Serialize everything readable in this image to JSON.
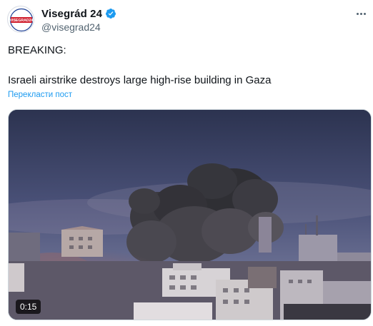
{
  "account": {
    "display_name": "Visegrád 24",
    "handle": "@visegrad24",
    "avatar_text": "VISEGRAD24",
    "verified_icon": "verified-badge-icon"
  },
  "tweet": {
    "line1": "BREAKING:",
    "line2": "Israeli airstrike destroys large high-rise building in Gaza",
    "translate_label": "Перекласти пост"
  },
  "media": {
    "type": "video",
    "duration": "0:15"
  },
  "colors": {
    "link": "#1d9bf0",
    "verified": "#1d9bf0",
    "secondary_text": "#536471",
    "brand_red": "#d0202f",
    "brand_blue": "#1c3f94"
  }
}
